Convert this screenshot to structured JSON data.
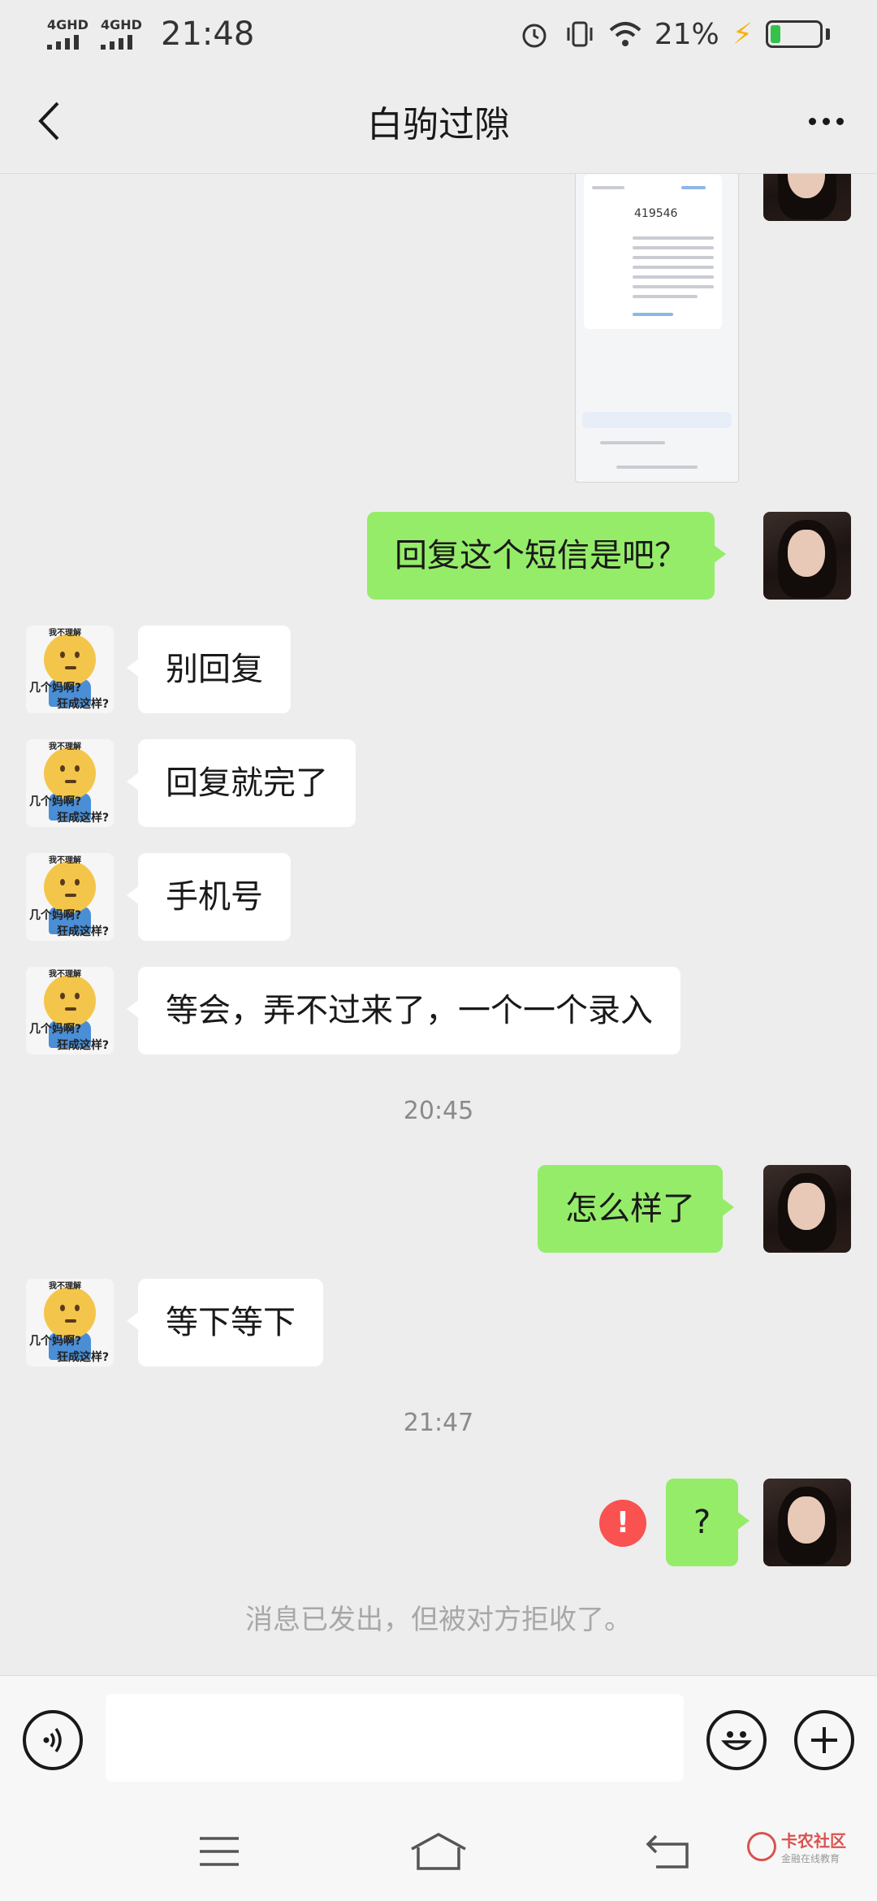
{
  "status_bar": {
    "network_1": "4GHD",
    "network_2": "4GHD",
    "time": "21:48",
    "battery": "21%"
  },
  "header": {
    "title": "白驹过隙"
  },
  "messages": [
    {
      "text": "回复这个短信是吧？"
    },
    {
      "text": "别回复"
    },
    {
      "text": "回复就完了"
    },
    {
      "text": "手机号"
    },
    {
      "text": "等会，弄不过来了，一个一个录入"
    },
    {
      "text": "怎么样了"
    },
    {
      "text": "等下等下"
    },
    {
      "text": "?"
    }
  ],
  "timestamps": [
    "20:45",
    "21:47"
  ],
  "screenshot_message": {
    "code": "419546"
  },
  "sticker_avatar": {
    "caption_top": "我不理解",
    "caption_left": "几个妈啊?",
    "caption_bottom": "狂成这样?"
  },
  "error_mark": "!",
  "reject_note": "消息已发出，但被对方拒收了。",
  "input": {
    "value": "",
    "placeholder": ""
  },
  "watermark": {
    "main": "卡农社区",
    "sub": "金融在线教育"
  },
  "colors": {
    "my_bubble": "#95ec69",
    "other_bubble": "#ffffff",
    "background": "#ededed",
    "error": "#fa5151"
  },
  "icons": [
    "back-icon",
    "more-icon",
    "alarm-icon",
    "vibrate-icon",
    "wifi-icon",
    "battery-icon",
    "voice-icon",
    "emoji-icon",
    "plus-icon",
    "menu-icon",
    "home-icon",
    "back-nav-icon"
  ]
}
